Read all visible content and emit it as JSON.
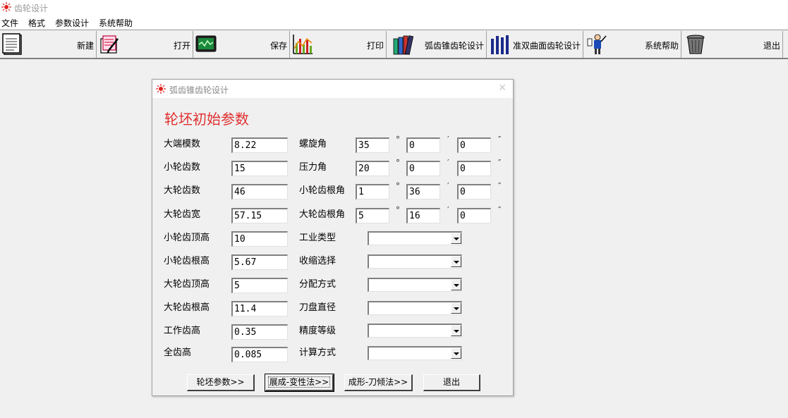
{
  "window": {
    "title": "齿轮设计"
  },
  "menu": [
    "文件",
    "格式",
    "参数设计",
    "系统帮助"
  ],
  "toolbar": [
    {
      "label": "新建",
      "icon": "document-icon"
    },
    {
      "label": "打开",
      "icon": "open-edit-icon"
    },
    {
      "label": "保存",
      "icon": "monitor-save-icon"
    },
    {
      "label": "打印",
      "icon": "chart-print-icon"
    },
    {
      "label": "弧齿锥齿轮设计",
      "icon": "books-icon"
    },
    {
      "label": "准双曲面齿轮设计",
      "icon": "bar-columns-icon"
    },
    {
      "label": "系统帮助",
      "icon": "help-person-icon"
    },
    {
      "label": "退出",
      "icon": "trash-can-icon"
    }
  ],
  "dialog": {
    "title": "弧齿锥齿轮设计",
    "heading": "轮坯初始参数",
    "left_fields": [
      {
        "label": "大端模数",
        "value": "8.22"
      },
      {
        "label": "小轮齿数",
        "value": "15"
      },
      {
        "label": "大轮齿数",
        "value": "46"
      },
      {
        "label": "大轮齿宽",
        "value": "57.15"
      },
      {
        "label": "小轮齿顶高",
        "value": "10"
      },
      {
        "label": "小轮齿根高",
        "value": "5.67"
      },
      {
        "label": "大轮齿顶高",
        "value": "5"
      },
      {
        "label": "大轮齿根高",
        "value": "11.4"
      },
      {
        "label": "工作齿高",
        "value": "0.35"
      },
      {
        "label": "全齿高",
        "value": "0.085"
      }
    ],
    "angle_fields": [
      {
        "label": "螺旋角",
        "deg": "35",
        "min": "0",
        "sec": "0"
      },
      {
        "label": "压力角",
        "deg": "20",
        "min": "0",
        "sec": "0"
      },
      {
        "label": "小轮齿根角",
        "deg": "1",
        "min": "36",
        "sec": "0"
      },
      {
        "label": "大轮齿根角",
        "deg": "5",
        "min": "16",
        "sec": "0"
      }
    ],
    "angle_units": {
      "deg": "°",
      "min": "′",
      "sec": "″"
    },
    "dropdowns": [
      {
        "label": "工业类型",
        "value": ""
      },
      {
        "label": "收缩选择",
        "value": ""
      },
      {
        "label": "分配方式",
        "value": ""
      },
      {
        "label": "刀盘直径",
        "value": ""
      },
      {
        "label": "精度等级",
        "value": ""
      },
      {
        "label": "计算方式",
        "value": ""
      }
    ],
    "buttons": [
      "轮坯参数>>",
      "展成-变性法>>",
      "成形-刀倾法>>",
      "退出"
    ]
  },
  "colors": {
    "heading": "#e03030",
    "icon_red": "#e02020"
  }
}
